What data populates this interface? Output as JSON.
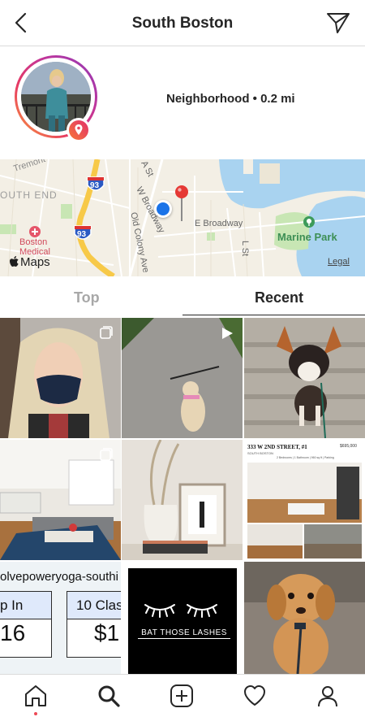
{
  "header": {
    "title": "South Boston",
    "back_icon": "back-chevron-icon",
    "send_icon": "direct-message-icon"
  },
  "location": {
    "meta": "Neighborhood • 0.2 mi"
  },
  "map": {
    "labels": {
      "tremont": "Tremont",
      "south_end": "OUTH END",
      "boston_medical": "Boston Medical",
      "w_broadway": "W Broadway",
      "e_broadway": "E Broadway",
      "old_colony": "Old Colony Ave",
      "l_st": "L St",
      "a_st": "A St",
      "marine_park": "Marine Park",
      "highway_93a": "93",
      "highway_93b": "93",
      "maps": "Maps",
      "legal": "Legal"
    }
  },
  "tabs": {
    "top": "Top",
    "recent": "Recent"
  },
  "posts": {
    "realestate_address": "333 W 2ND STREET, #1",
    "realestate_sub": "SOUTH BOSTON",
    "realestate_price": "$695,000",
    "realestate_details": "2 Bedrooms | 1 Bathroom | 960 sq ft | Parking",
    "yoga_handle": "olvepoweryoga-southi",
    "yoga_left_top": "p In",
    "yoga_left_bottom": "16",
    "yoga_right_top": "10 Clas",
    "yoga_right_bottom": "$1",
    "lashes_text": "BAT THOSE LASHES"
  },
  "colors": {
    "accent_red": "#ed4956",
    "map_water": "#a9d3f0",
    "map_park": "#c8e6b4",
    "location_blue": "#1a73e8"
  }
}
